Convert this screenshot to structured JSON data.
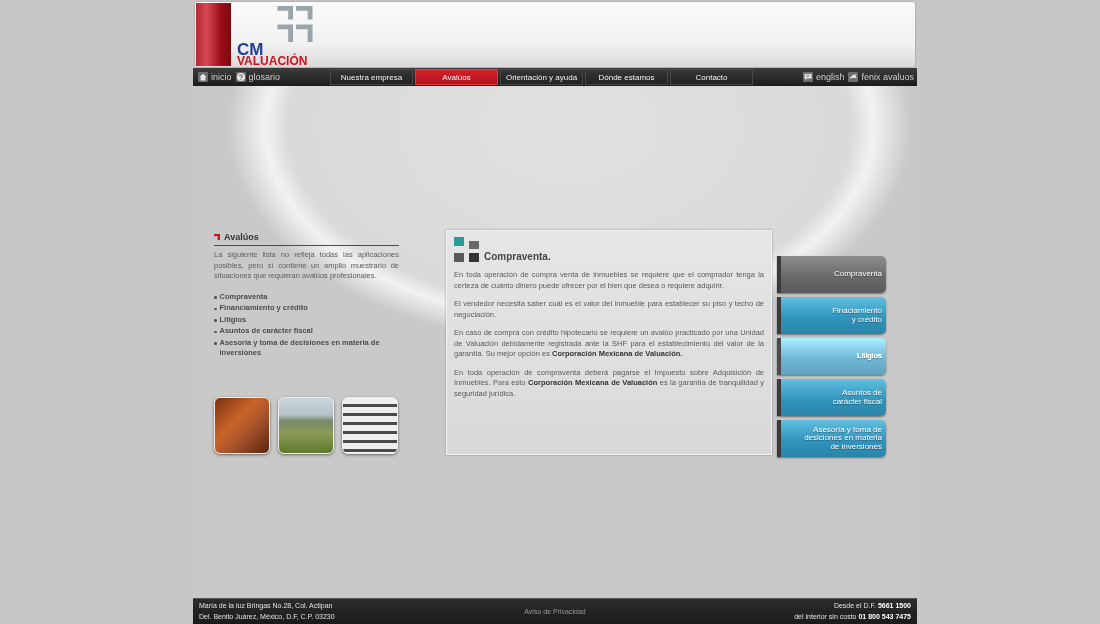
{
  "header": {
    "logo": {
      "line_1": "CM",
      "line_2": "VALUACIÓN"
    }
  },
  "nav": {
    "left_links": [
      {
        "label": "inicio",
        "kind": "home"
      },
      {
        "label": "glosario",
        "kind": "help"
      }
    ],
    "tabs": [
      {
        "label": "Nuestra empresa",
        "selected": false
      },
      {
        "label": "Avalúos",
        "selected": true
      },
      {
        "label": "Orientación y ayuda",
        "selected": false
      },
      {
        "label": "Dónde estamos",
        "selected": false
      },
      {
        "label": "Contacto",
        "selected": false
      }
    ],
    "right_links": [
      {
        "label": "english",
        "kind": "chat"
      },
      {
        "label": "fenix avaluos",
        "kind": "wing"
      }
    ]
  },
  "sidebar": {
    "title": "Avalúos",
    "intro": "La siguiente lista no refleja todas las aplicaciones posibles, pero sí contiene un amplio muestrario de situaciones que requieran avalúos profesionales.",
    "items": [
      "Compraventa",
      "Financiamiento y crédito",
      "Litigios",
      "Asuntos de carácter fiscal",
      "Asesoría y toma de decisiones en materia de inversiones"
    ],
    "photos": [
      {
        "kind": "building"
      },
      {
        "kind": "landscape"
      },
      {
        "kind": "apartments"
      }
    ]
  },
  "article": {
    "title": "Compraventa.",
    "paragraphs": [
      "En toda operación de compra venta de inmuebles se requiere que el comprador tenga la certeza de cuánto dinero puede ofrecer por el bien que desea o requiere adquirir.",
      "El vendedor necesita saber cuál es el valor del inmueble para establecer su piso y techo de negociación.",
      "En caso de compra con crédito hipotecario se requiere un avalúo practicado por una Unidad de Valuación debidamente registrada ante la SHF para el establecimiento del valor de la garantía. Su mejor opción es **Corporación Mexicana de Valuación.**",
      "En toda operación de compraventa deberá pagarse el Impuesto sobre Adquisición de Inmuebles. Para esto **Corporación Mexicana de Valuación** es la garantía de tranquilidad y seguridad jurídica."
    ]
  },
  "side_buttons": [
    {
      "label": "Compraventa",
      "selected": true,
      "dimmed": false
    },
    {
      "label": "Finaciamiento\ny crédito",
      "selected": false,
      "dimmed": false
    },
    {
      "label": "Litigios",
      "selected": false,
      "dimmed": true
    },
    {
      "label": "Asuntos de\ncarácter fiscal",
      "selected": false,
      "dimmed": false
    },
    {
      "label": "Asesoría y toma de\ndesiciones en materia\nde inversiones",
      "selected": false,
      "dimmed": false
    }
  ],
  "footer": {
    "address": [
      "María de la luz Bringas No.28, Col. Actipan",
      "Del. Benito Juárez, México, D.F, C.P. 03230"
    ],
    "privacy_link": "Aviso de Privacidad",
    "phones": [
      "Desde el D.F. **5661 1500**",
      "del interior sin costo **01 800 543 7475**"
    ]
  }
}
